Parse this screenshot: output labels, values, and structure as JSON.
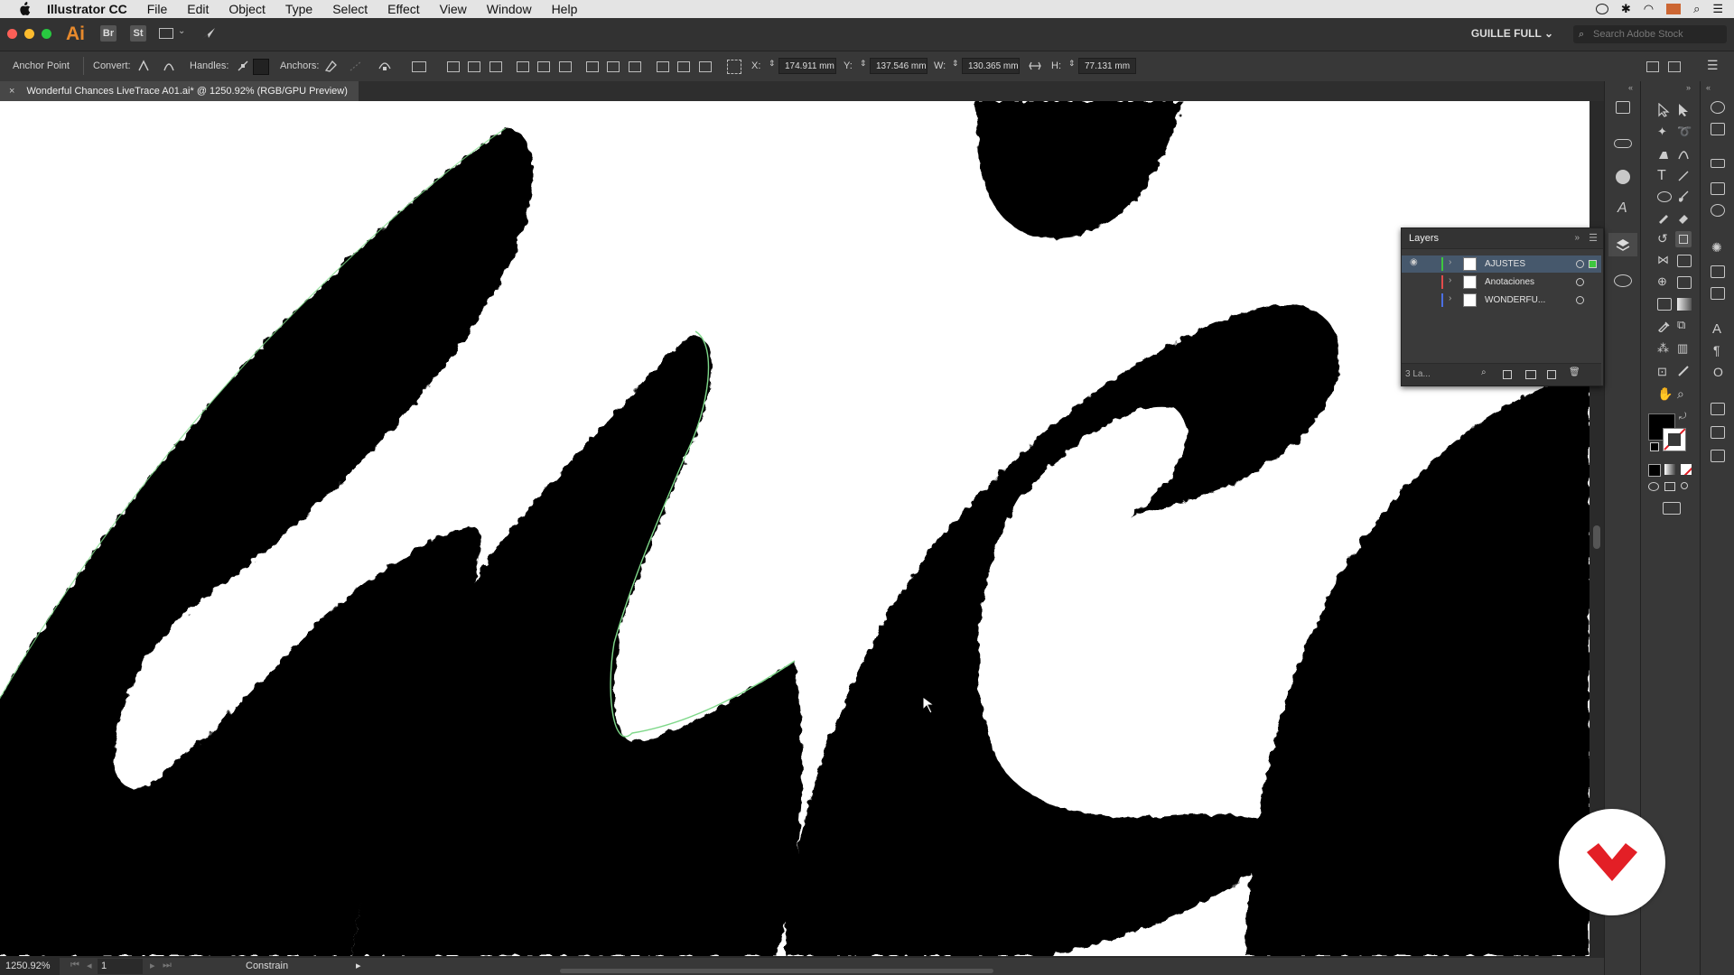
{
  "menubar": {
    "app_name": "Illustrator CC",
    "items": [
      "File",
      "Edit",
      "Object",
      "Type",
      "Select",
      "Effect",
      "View",
      "Window",
      "Help"
    ]
  },
  "appbar": {
    "logo": "Ai",
    "bridge": "Br",
    "stock": "St",
    "workspace": "GUILLE FULL",
    "search_placeholder": "Search Adobe Stock"
  },
  "control": {
    "tool_label": "Anchor Point",
    "convert_label": "Convert:",
    "handles_label": "Handles:",
    "anchors_label": "Anchors:",
    "x_label": "X:",
    "x_value": "174.911 mm",
    "y_label": "Y:",
    "y_value": "137.546 mm",
    "w_label": "W:",
    "w_value": "130.365 mm",
    "h_label": "H:",
    "h_value": "77.131 mm"
  },
  "document_tab": {
    "title": "Wonderful Chances LiveTrace A01.ai* @ 1250.92% (RGB/GPU Preview)",
    "close": "×"
  },
  "layers_panel": {
    "title": "Layers",
    "layers": [
      {
        "name": "AJUSTES",
        "color": "#3ec73e",
        "selected": true
      },
      {
        "name": "Anotaciones",
        "color": "#e34b4b",
        "selected": false
      },
      {
        "name": "WONDERFU...",
        "color": "#4b6fe3",
        "selected": false
      }
    ],
    "count_label": "3 La..."
  },
  "status": {
    "zoom": "1250.92%",
    "artboard": "1",
    "mode": "Constrain"
  },
  "colors": {
    "fill": "#000000",
    "accent_badge": "#e31f26",
    "path_outline": "#7fd88a"
  }
}
